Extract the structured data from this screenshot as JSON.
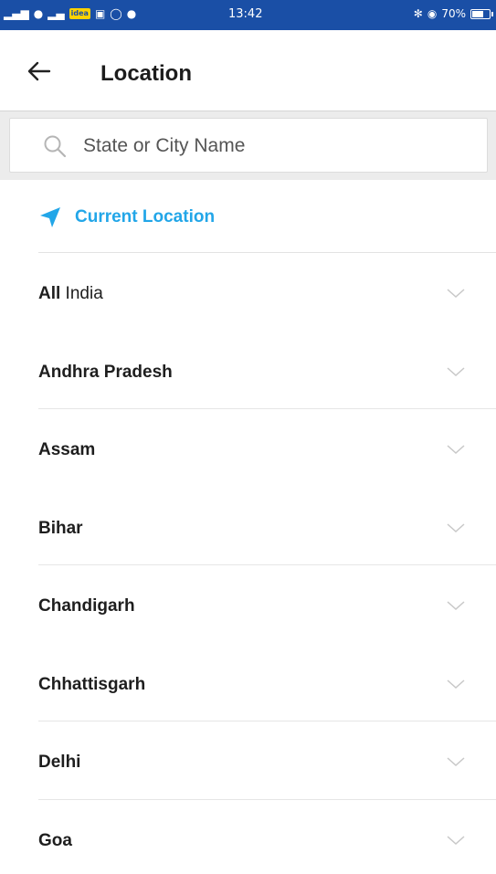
{
  "status_bar": {
    "time": "13:42",
    "battery_text": "70%",
    "battery_level": 0.7,
    "network_label": "idea"
  },
  "header": {
    "back_icon": "arrow-left-icon",
    "title": "Location"
  },
  "search": {
    "placeholder": "State or City Name",
    "value": "",
    "icon": "search-icon"
  },
  "current_location": {
    "label": "Current Location",
    "icon": "location-arrow-icon",
    "color": "#22a6e8"
  },
  "states": [
    {
      "label_bold": "All",
      "label_rest": " India",
      "show_sep": false
    },
    {
      "label_bold": "Andhra Pradesh",
      "label_rest": "",
      "show_sep": true
    },
    {
      "label_bold": "Assam",
      "label_rest": "",
      "show_sep": false
    },
    {
      "label_bold": "Bihar",
      "label_rest": "",
      "show_sep": true
    },
    {
      "label_bold": "Chandigarh",
      "label_rest": "",
      "show_sep": false
    },
    {
      "label_bold": "Chhattisgarh",
      "label_rest": "",
      "show_sep": true
    },
    {
      "label_bold": "Delhi",
      "label_rest": "",
      "show_sep": true
    },
    {
      "label_bold": "Goa",
      "label_rest": "",
      "show_sep": false
    }
  ],
  "colors": {
    "status_bar": "#1a4fa6",
    "accent": "#22a6e8"
  }
}
